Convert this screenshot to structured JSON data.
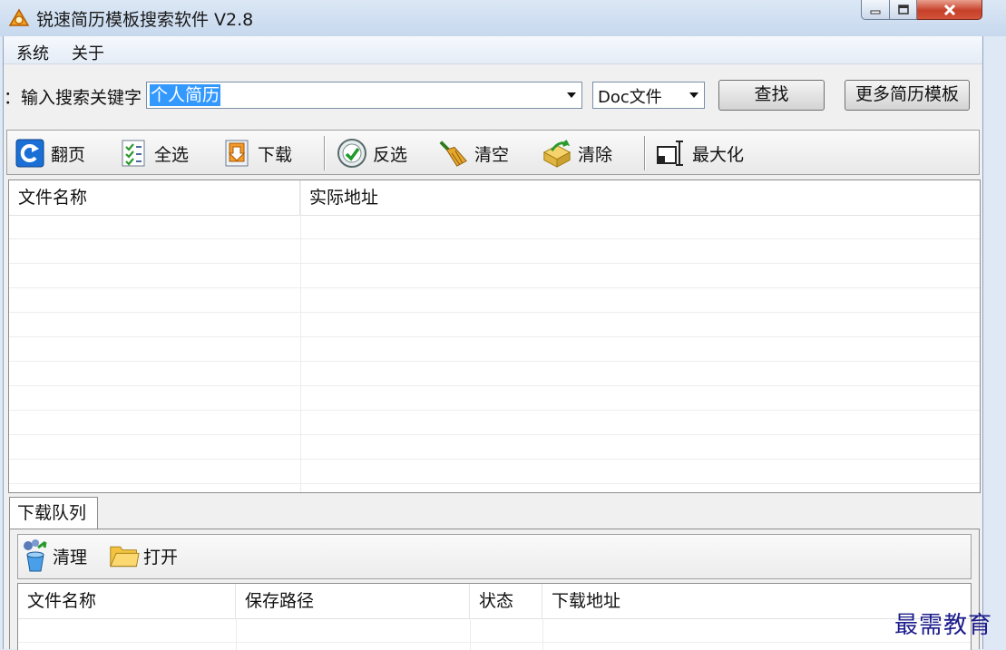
{
  "window": {
    "title": "锐速简历模板搜索软件  V2.8"
  },
  "menu": {
    "items": [
      {
        "label": "系统"
      },
      {
        "label": "关于"
      }
    ]
  },
  "search": {
    "label": "输入搜索关键字：",
    "keyword": "个人简历",
    "file_type": "Doc文件",
    "search_button": "查找",
    "more_button": "更多简历模板"
  },
  "toolbar": {
    "items": [
      {
        "label": "翻页",
        "icon": "page-turn-icon"
      },
      {
        "label": "全选",
        "icon": "select-all-icon"
      },
      {
        "label": "下载",
        "icon": "download-icon"
      },
      {
        "label": "反选",
        "icon": "invert-selection-icon"
      },
      {
        "label": "清空",
        "icon": "broom-icon"
      },
      {
        "label": "清除",
        "icon": "remove-icon"
      },
      {
        "label": "最大化",
        "icon": "maximize-icon"
      }
    ]
  },
  "results": {
    "columns": [
      "文件名称",
      "实际地址"
    ]
  },
  "tabs": {
    "download_queue": "下载队列"
  },
  "queue": {
    "toolbar": {
      "clean": "清理",
      "open": "打开"
    },
    "columns": [
      "文件名称",
      "保存路径",
      "状态",
      "下载地址"
    ]
  },
  "watermark": "最需教育",
  "colors": {
    "selection": "#3399ff",
    "close_button": "#c7402a",
    "titlebar": "#c7d9ee"
  }
}
